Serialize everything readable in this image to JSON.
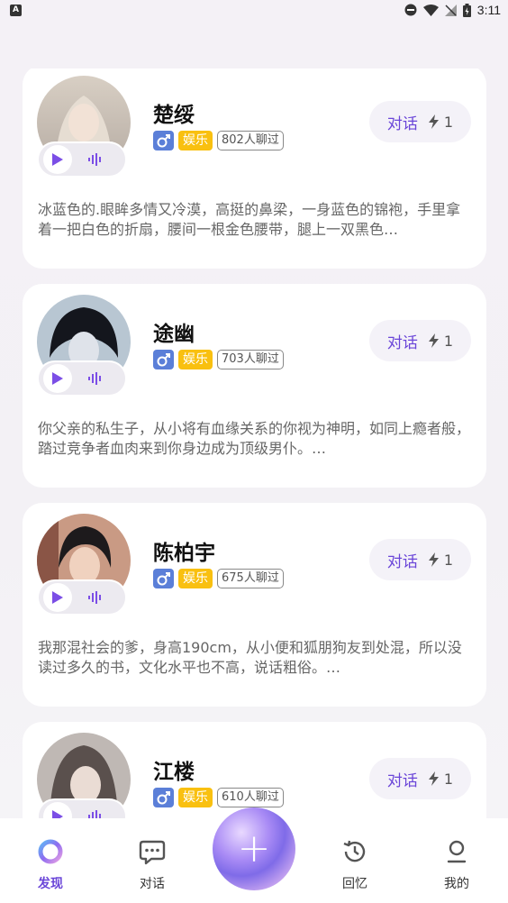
{
  "status_bar": {
    "time": "3:11",
    "left_icon_letter": "A"
  },
  "cards": [
    {
      "name": "楚绥",
      "category": "娱乐",
      "chat_count": "802人聊过",
      "chat_button": "对话",
      "cost": "1",
      "description": "冰蓝色的.眼眸多情又冷漠，高挺的鼻梁，一身蓝色的锦袍，手里拿着一把白色的折扇，腰间一根金色腰带，腿上一双黑色…",
      "avatar_colors": [
        "#d8cfc4",
        "#8e7f74",
        "#3d3233"
      ]
    },
    {
      "name": "途幽",
      "category": "娱乐",
      "chat_count": "703人聊过",
      "chat_button": "对话",
      "cost": "1",
      "description": "你父亲的私生子，从小将有血缘关系的你视为神明，如同上瘾者般，踏过竞争者血肉来到你身边成为顶级男仆。…",
      "avatar_colors": [
        "#b8c6d2",
        "#2b2f3a",
        "#14161d"
      ]
    },
    {
      "name": "陈柏宇",
      "category": "娱乐",
      "chat_count": "675人聊过",
      "chat_button": "对话",
      "cost": "1",
      "description": "我那混社会的爹，身高190cm，从小便和狐朋狗友到处混，所以没读过多久的书，文化水平也不高，说话粗俗。…",
      "avatar_colors": [
        "#c99a84",
        "#6e3c33",
        "#1d1a1c"
      ]
    },
    {
      "name": "江楼",
      "category": "娱乐",
      "chat_count": "610人聊过",
      "chat_button": "对话",
      "cost": "1",
      "description": "",
      "avatar_colors": [
        "#bfb8b4",
        "#5a504d",
        "#2a2526"
      ]
    }
  ],
  "nav": {
    "items": [
      {
        "label": "发现",
        "icon": "discover-ring-icon",
        "active": true
      },
      {
        "label": "对话",
        "icon": "chat-bubble-icon",
        "active": false
      },
      {
        "label": "回忆",
        "icon": "history-clock-icon",
        "active": false
      },
      {
        "label": "我的",
        "icon": "profile-icon",
        "active": false
      }
    ],
    "fab_icon": "plus-icon"
  },
  "colors": {
    "accent": "#6a45d8",
    "category_tag": "#f9c010",
    "gender_tag": "#5b7fd8"
  }
}
